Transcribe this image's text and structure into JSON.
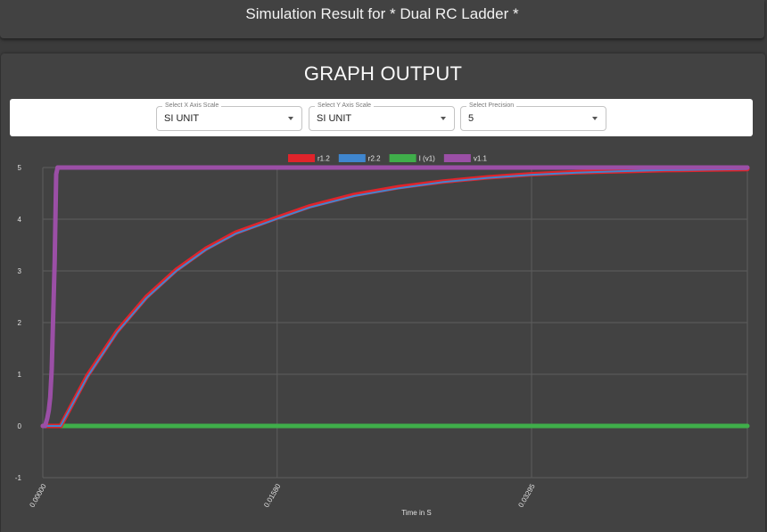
{
  "header": {
    "title": "Simulation Result for * Dual RC Ladder *"
  },
  "graph": {
    "title": "GRAPH OUTPUT"
  },
  "controls": [
    {
      "label": "Select X Axis Scale",
      "value": "SI UNIT"
    },
    {
      "label": "Select Y Axis Scale",
      "value": "SI UNIT"
    },
    {
      "label": "Select Precision",
      "value": "5"
    }
  ],
  "chart_data": {
    "type": "line",
    "xlabel": "Time in S",
    "ylabel": "",
    "xlim": [
      0,
      0.0475
    ],
    "ylim": [
      -1,
      5
    ],
    "x_ticks": [
      "0.00000",
      "0.01580",
      "0.03295"
    ],
    "y_ticks": [
      "-1",
      "0",
      "1",
      "2",
      "3",
      "4",
      "5"
    ],
    "grid": true,
    "legend_position": "top",
    "series": [
      {
        "name": "r1.2",
        "color": "#e0242b",
        "width": 5,
        "x": [
          0,
          0.001,
          0.0012,
          0.003,
          0.005,
          0.007,
          0.009,
          0.011,
          0.013,
          0.0158,
          0.018,
          0.021,
          0.024,
          0.027,
          0.03,
          0.033,
          0.036,
          0.039,
          0.042,
          0.045,
          0.0475
        ],
        "y": [
          0,
          0,
          0,
          0.97,
          1.83,
          2.5,
          3.02,
          3.43,
          3.74,
          4.03,
          4.25,
          4.47,
          4.62,
          4.73,
          4.81,
          4.87,
          4.91,
          4.93,
          4.95,
          4.96,
          4.97
        ]
      },
      {
        "name": "r2.2",
        "color": "#3f86cf",
        "width": 2,
        "x": [
          0,
          0.001,
          0.0012,
          0.003,
          0.005,
          0.007,
          0.009,
          0.011,
          0.013,
          0.0158,
          0.018,
          0.021,
          0.024,
          0.027,
          0.03,
          0.033,
          0.036,
          0.039,
          0.042,
          0.045,
          0.0475
        ],
        "y": [
          0,
          0,
          0,
          0.95,
          1.81,
          2.48,
          3.0,
          3.41,
          3.72,
          4.01,
          4.23,
          4.45,
          4.6,
          4.72,
          4.8,
          4.86,
          4.9,
          4.93,
          4.95,
          4.96,
          4.97
        ]
      },
      {
        "name": "I (v1)",
        "color": "#3fae4a",
        "width": 5,
        "x": [
          0,
          0.0475
        ],
        "y": [
          0,
          0
        ]
      },
      {
        "name": "v1.1",
        "color": "#9b4fa6",
        "width": 5,
        "x": [
          0,
          0.00015,
          0.0003,
          0.0004,
          0.0005,
          0.0006,
          0.0007,
          0.0008,
          0.0009,
          0.001,
          0.0475
        ],
        "y": [
          0,
          0,
          0.15,
          0.3,
          0.55,
          1.1,
          2.1,
          3.18,
          4.87,
          5,
          5
        ],
        "markers": [
          0.0004,
          0.0005,
          0.0006,
          0.0007,
          0.0008,
          0.0009
        ]
      }
    ]
  }
}
